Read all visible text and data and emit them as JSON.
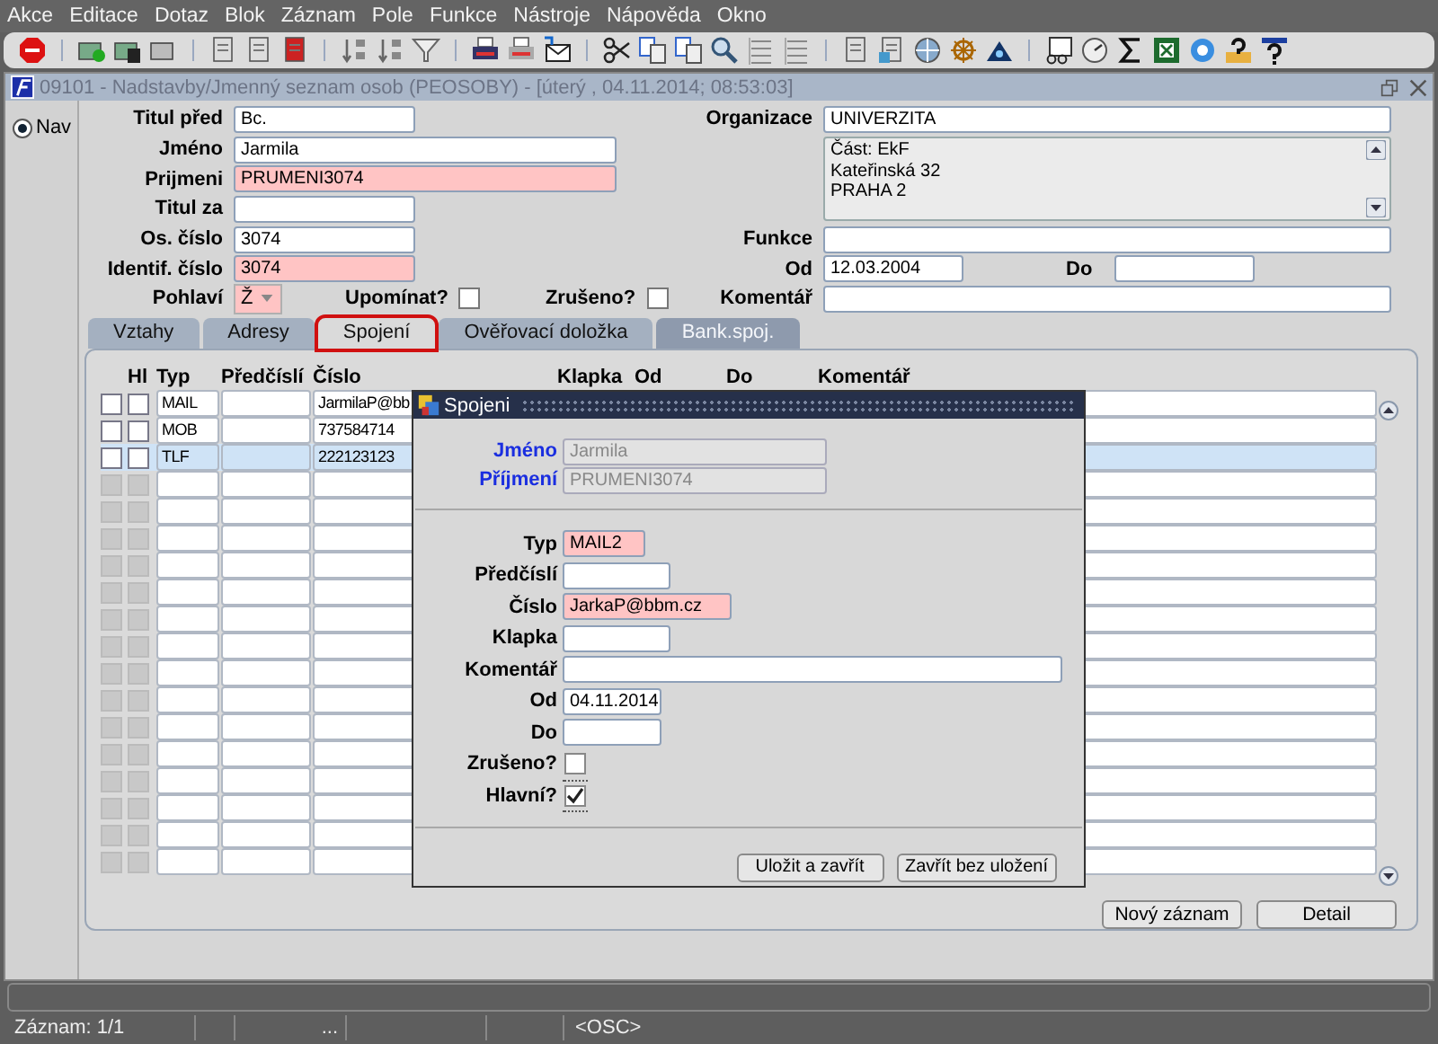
{
  "menu": [
    "Akce",
    "Editace",
    "Dotaz",
    "Blok",
    "Záznam",
    "Pole",
    "Funkce",
    "Nástroje",
    "Nápověda",
    "Okno"
  ],
  "window": {
    "title": "09101 - Nadstavby/Jmenný seznam osob (PEOSOBY) - [úterý  , 04.11.2014; 08:53:03]"
  },
  "nav": {
    "label": "Nav",
    "selected": true
  },
  "form": {
    "titul_pred": {
      "label": "Titul před",
      "value": "Bc.",
      "required": false
    },
    "jmeno": {
      "label": "Jméno",
      "value": "Jarmila",
      "required": false
    },
    "prijmeni": {
      "label": "Prijmeni",
      "value": "PRUMENI3074",
      "required": true
    },
    "titul_za": {
      "label": "Titul za",
      "required": false
    },
    "os_cislo": {
      "label": "Os. číslo",
      "value": "3074",
      "required": false
    },
    "identif_cislo": {
      "label": "Identif. číslo",
      "value": "3074",
      "required": true
    },
    "pohlavi": {
      "label": "Pohlaví",
      "value": "Ž",
      "required": true
    },
    "upominat": {
      "label": "Upomínat?",
      "checked": false
    },
    "zruseno": {
      "label": "Zrušeno?",
      "checked": false
    },
    "organizace": {
      "label": "Organizace",
      "value": "UNIVERZITA"
    },
    "address_lines": [
      "Část: EkF",
      "Kateřinská 32",
      "PRAHA 2"
    ],
    "funkce": {
      "label": "Funkce"
    },
    "od": {
      "label": "Od",
      "value": "12.03.2004"
    },
    "do": {
      "label": "Do"
    },
    "komentar": {
      "label": "Komentář"
    }
  },
  "tabs": [
    {
      "label": "Vztahy",
      "selected": false,
      "disabled": false
    },
    {
      "label": "Adresy",
      "selected": false,
      "disabled": false
    },
    {
      "label": "Spojení",
      "selected": true,
      "disabled": false
    },
    {
      "label": "Ověřovací doložka",
      "selected": false,
      "disabled": false
    },
    {
      "label": "Bank.spoj.",
      "selected": false,
      "disabled": true
    }
  ],
  "table": {
    "columns": [
      "Hl",
      "Typ",
      "Předčíslí",
      "Číslo",
      "Klapka",
      "Od",
      "Do",
      "Komentář"
    ],
    "rows": [
      {
        "kind": "record",
        "typ": "MAIL",
        "cislo": "JarmilaP@bb",
        "flag": false,
        "hl": false,
        "selected": false
      },
      {
        "kind": "record",
        "typ": "MOB",
        "cislo": "737584714",
        "flag": false,
        "hl": false,
        "selected": false
      },
      {
        "kind": "record",
        "typ": "TLF",
        "cislo": "222123123",
        "flag": false,
        "hl": false,
        "selected": true
      },
      {
        "kind": "empty",
        "flag": false,
        "hl": false
      },
      {
        "kind": "empty",
        "flag": false,
        "hl": false
      },
      {
        "kind": "empty",
        "flag": false,
        "hl": false
      },
      {
        "kind": "empty",
        "flag": false,
        "hl": false
      },
      {
        "kind": "empty",
        "flag": false,
        "hl": false
      },
      {
        "kind": "empty",
        "flag": false,
        "hl": false
      },
      {
        "kind": "empty",
        "flag": false,
        "hl": false
      },
      {
        "kind": "empty",
        "flag": false,
        "hl": false
      },
      {
        "kind": "empty",
        "flag": false,
        "hl": false
      },
      {
        "kind": "empty",
        "flag": false,
        "hl": false
      },
      {
        "kind": "empty",
        "flag": false,
        "hl": false
      },
      {
        "kind": "empty",
        "flag": false,
        "hl": false
      },
      {
        "kind": "empty",
        "flag": false,
        "hl": false
      },
      {
        "kind": "empty",
        "flag": false,
        "hl": false
      },
      {
        "kind": "empty",
        "flag": false,
        "hl": false
      }
    ]
  },
  "buttons": [
    "Nový záznam",
    "Detail"
  ],
  "dialog": {
    "title": "Spojeni",
    "header_fields": [
      {
        "label": "Jméno",
        "value": "Jarmila",
        "disabled": true
      },
      {
        "label": "Příjmení",
        "value": "PRUMENI3074",
        "disabled": true
      }
    ],
    "fields": [
      {
        "kind": "text",
        "label": "Typ",
        "value": "MAIL2",
        "required": true
      },
      {
        "kind": "text",
        "label": "Předčíslí",
        "required": false
      },
      {
        "kind": "text",
        "label": "Číslo",
        "value": "JarkaP@bbm.cz",
        "required": true
      },
      {
        "kind": "text",
        "label": "Klapka",
        "required": false
      },
      {
        "kind": "text",
        "label": "Komentář",
        "required": false
      },
      {
        "kind": "text",
        "label": "Od",
        "value": "04.11.2014",
        "required": false
      },
      {
        "kind": "text",
        "label": "Do",
        "required": false
      },
      {
        "kind": "checkbox",
        "label": "Zrušeno?",
        "checked": false,
        "focused": false
      },
      {
        "kind": "checkbox",
        "label": "Hlavní?",
        "checked": true,
        "focused": true
      }
    ],
    "buttons": [
      "Uložit a zavřít",
      "Zavřít bez uložení"
    ]
  },
  "status": {
    "record": "Záznam: 1/1",
    "segment_3": "...",
    "mode": "<OSC>"
  }
}
